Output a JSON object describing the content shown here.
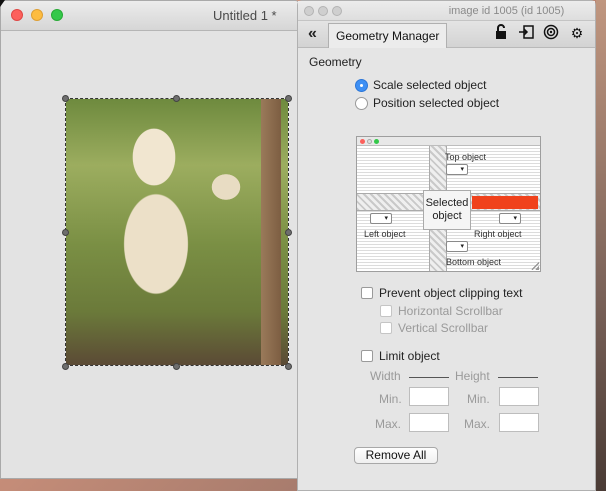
{
  "document_window": {
    "title": "Untitled 1 *"
  },
  "panel": {
    "title": "image id 1005 (id 1005)",
    "tab_label": "Geometry Manager",
    "section_label": "Geometry",
    "radio_options": [
      {
        "label": "Scale selected object",
        "checked": true
      },
      {
        "label": "Position selected object",
        "checked": false
      }
    ],
    "diagram": {
      "center_label_line1": "Selected",
      "center_label_line2": "object",
      "top_label": "Top object",
      "left_label": "Left object",
      "right_label": "Right object",
      "bottom_label": "Bottom object",
      "highlight_color": "#f0421c"
    },
    "clipping": {
      "label": "Prevent object clipping text",
      "horizontal_label": "Horizontal Scrollbar",
      "vertical_label": "Vertical Scrollbar"
    },
    "limit": {
      "label": "Limit object",
      "width_label": "Width",
      "height_label": "Height",
      "min_label": "Min.",
      "max_label": "Max."
    },
    "remove_all_label": "Remove All"
  }
}
